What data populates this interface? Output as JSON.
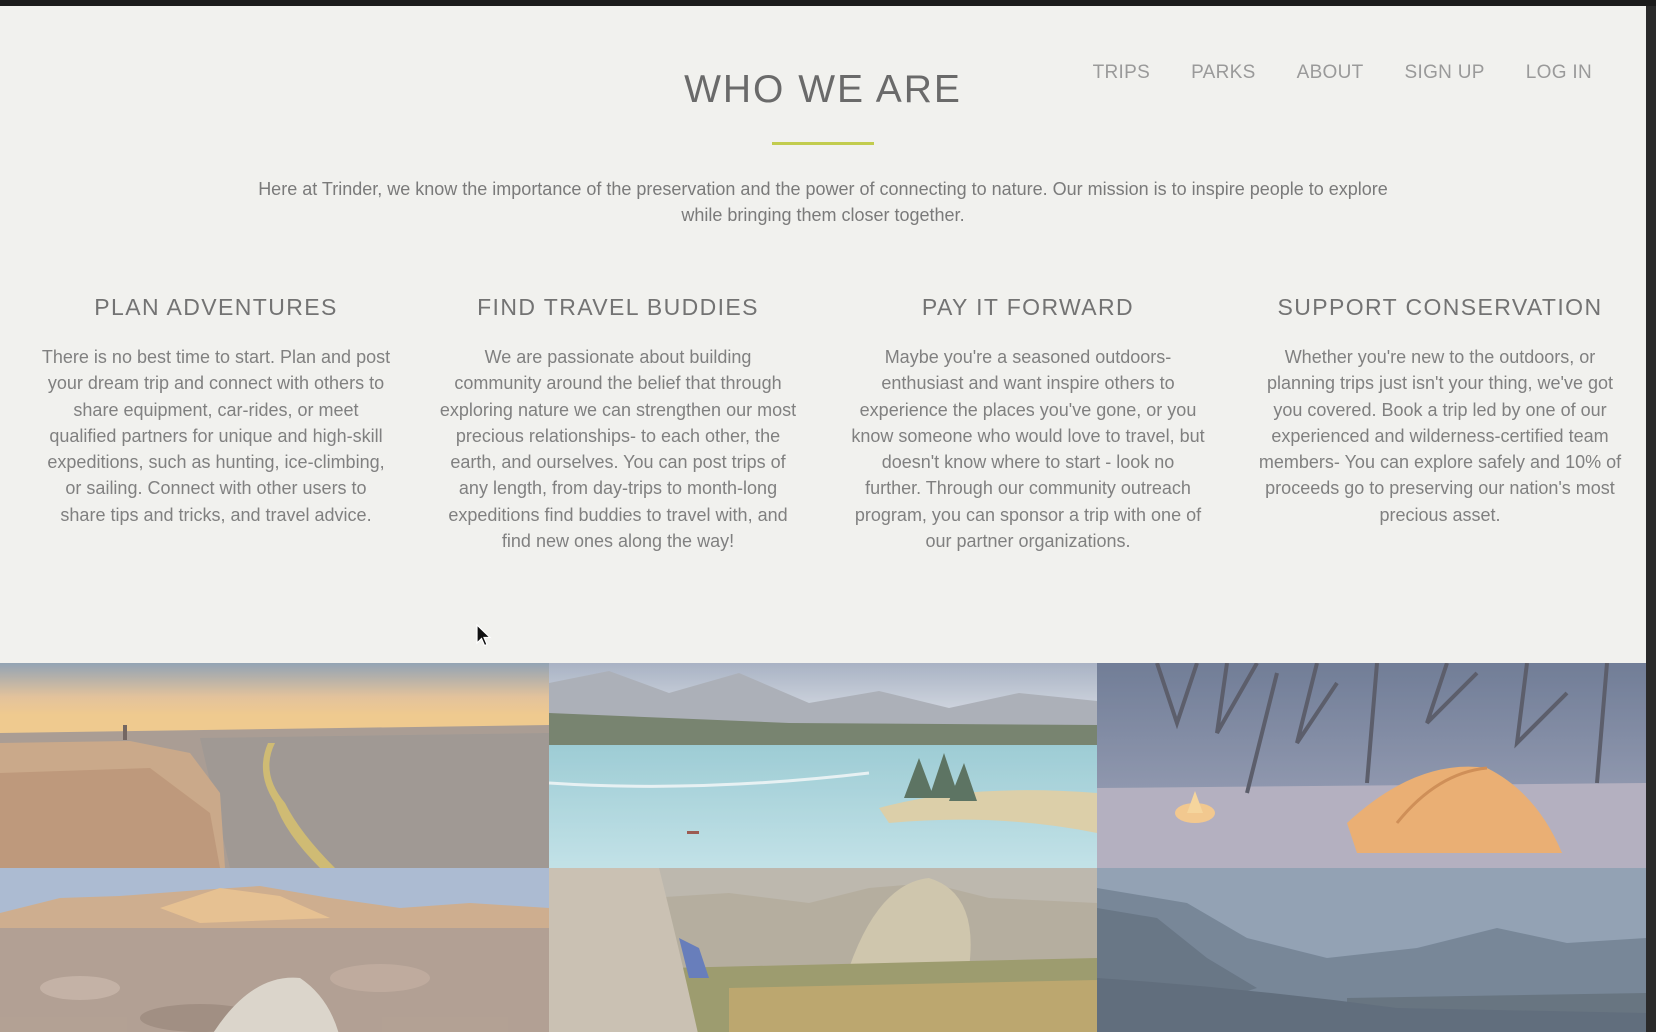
{
  "nav": {
    "items": [
      {
        "label": "TRIPS"
      },
      {
        "label": "PARKS"
      },
      {
        "label": "ABOUT"
      },
      {
        "label": "SIGN UP"
      },
      {
        "label": "LOG IN"
      }
    ]
  },
  "hero": {
    "title": "WHO WE ARE",
    "mission": "Here at Trinder, we know the importance of the preservation and the power of connecting to nature. Our mission is to inspire people to explore while bringing them closer together.",
    "accent_color": "#c2cc4e"
  },
  "features": [
    {
      "title": "PLAN ADVENTURES",
      "lines": [
        "There is no best time to start. Plan and post",
        "your dream trip and connect with others to",
        "share equipment, car-rides, or meet",
        "qualified partners for unique and high-skill",
        "expeditions, such as hunting, ice-climbing,",
        "or sailing. Connect with other users to",
        "share tips and tricks, and travel advice."
      ]
    },
    {
      "title": "FIND TRAVEL BUDDIES",
      "lines": [
        "We are passionate about building",
        "community around the belief that through",
        "exploring nature we can strengthen our most",
        "precious relationships- to each other, the",
        "earth, and ourselves. You can post trips of",
        "any length, from day-trips to month-long",
        "expeditions find buddies to travel with, and",
        "find new ones along the way!"
      ]
    },
    {
      "title": "PAY IT FORWARD",
      "lines": [
        "Maybe you're a seasoned outdoors-",
        "enthusiast and want inspire others to",
        "experience the places you've gone, or you",
        "know someone who would love to travel, but",
        "doesn't know where to start - look no",
        "further. Through our community outreach",
        "program, you can sponsor a trip with one of",
        "our partner organizations."
      ]
    },
    {
      "title": "SUPPORT CONSERVATION",
      "lines": [
        "Whether you're new to the outdoors, or",
        "planning trips just isn't your thing, we've got",
        "you covered. Book a trip led by one of our",
        "experienced and wilderness-certified team",
        "members- You can explore safely and 10% of",
        "proceeds go to preserving our nation's most",
        "precious asset."
      ]
    }
  ],
  "gallery": {
    "photos": [
      {
        "subject": "canyon-sunset-photo"
      },
      {
        "subject": "mountain-lake-photo"
      },
      {
        "subject": "tent-campfire-night-photo"
      },
      {
        "subject": "rocky-campsite-tent-photo"
      },
      {
        "subject": "rock-climber-valley-photo"
      },
      {
        "subject": "blue-mountain-forest-photo"
      }
    ]
  }
}
